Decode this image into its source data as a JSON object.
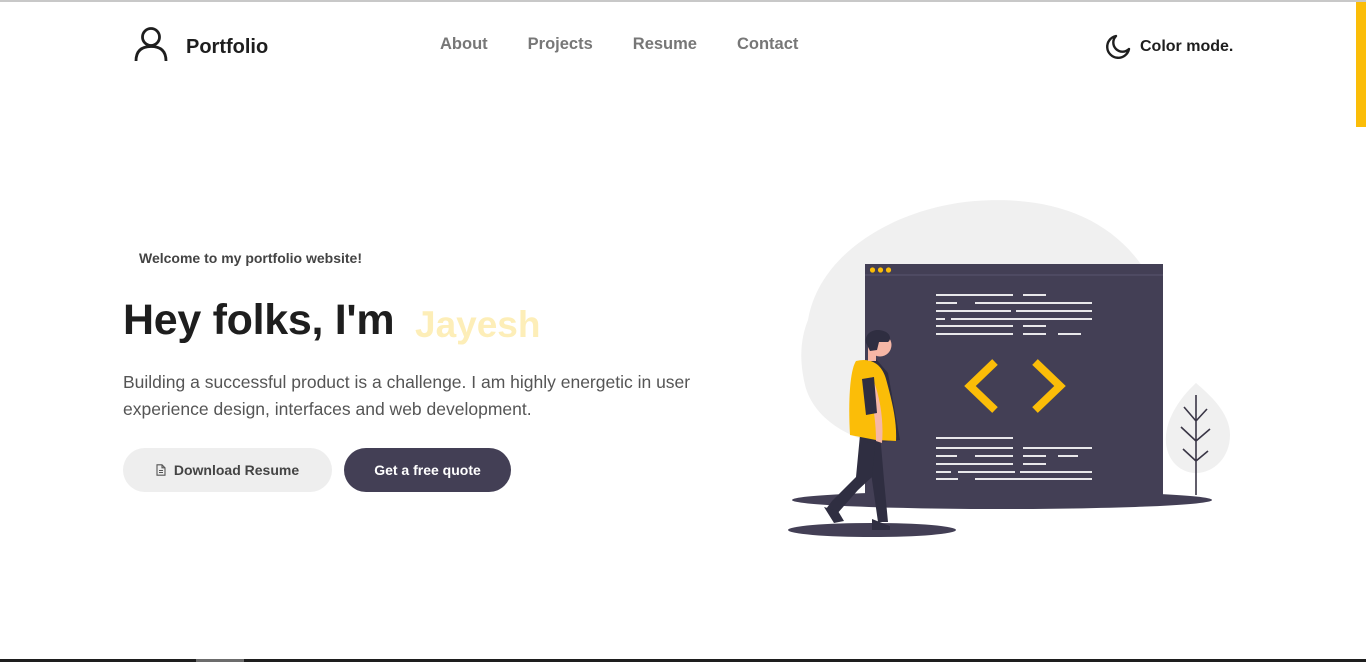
{
  "header": {
    "brand_name": "Portfolio",
    "user_icon": "user-outline-icon",
    "nav": [
      {
        "label": "About"
      },
      {
        "label": "Projects"
      },
      {
        "label": "Resume"
      },
      {
        "label": "Contact"
      }
    ],
    "color_mode_icon": "moon-icon",
    "color_mode_label": "Color mode."
  },
  "hero": {
    "welcome": "Welcome to my portfolio website!",
    "headline": "Hey folks, I'm",
    "name": "Jayesh",
    "description": "Building a successful product is a challenge. I am highly energetic in user experience design, interfaces and web development.",
    "download_button": {
      "label": "Download Resume",
      "icon": "document-icon"
    },
    "quote_button": {
      "label": "Get a free quote"
    },
    "illustration": "developer-code-window-illustration"
  },
  "colors": {
    "accent": "#fbbd08",
    "name_text": "#fdeeb8",
    "dark": "#433f55",
    "text": "#1e1e1e",
    "muted": "#777777"
  }
}
